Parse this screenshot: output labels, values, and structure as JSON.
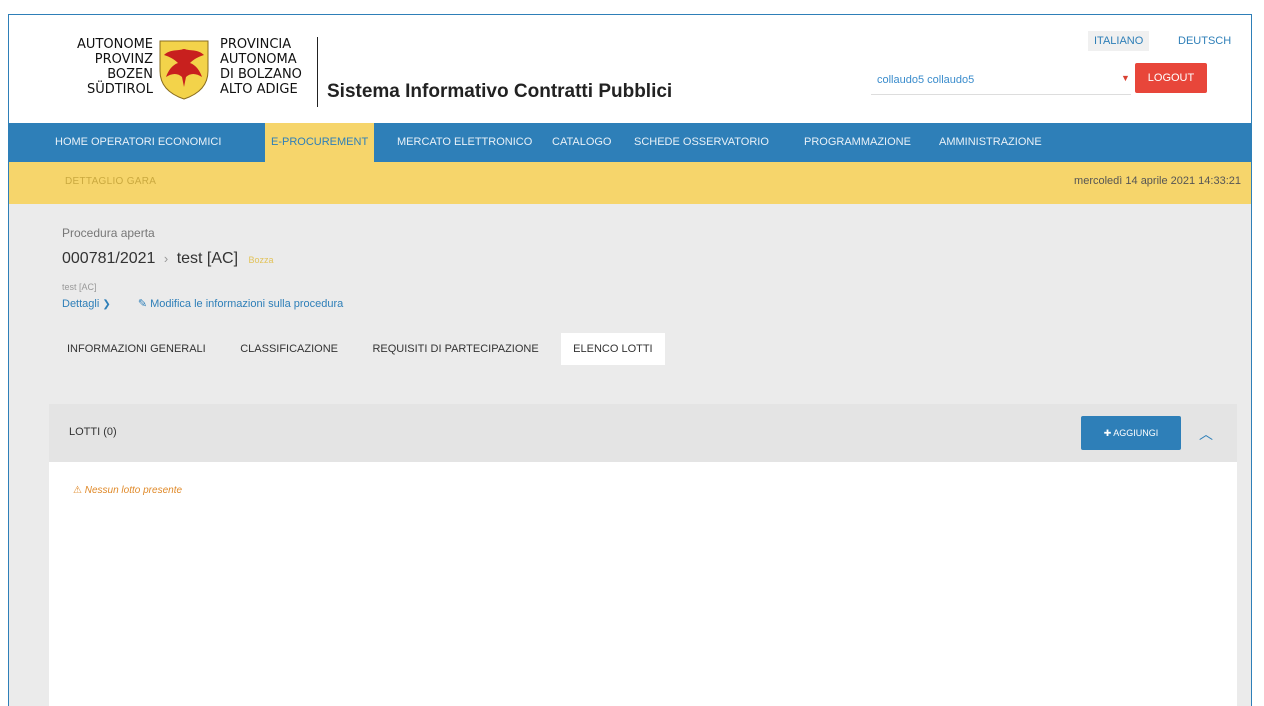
{
  "header": {
    "logo_left": [
      "AUTONOME",
      "PROVINZ",
      "BOZEN",
      "SÜDTIROL"
    ],
    "logo_right": [
      "PROVINCIA",
      "AUTONOMA",
      "DI BOLZANO",
      "ALTO ADIGE"
    ],
    "site_title": "Sistema Informativo Contratti Pubblici",
    "languages": [
      "ITALIANO",
      "DEUTSCH"
    ],
    "user": "collaudo5 collaudo5",
    "logout": "LOGOUT"
  },
  "nav": {
    "items": [
      "HOME",
      "OPERATORI ECONOMICI",
      "E-PROCUREMENT",
      "MERCATO ELETTRONICO",
      "CATALOGO",
      "SCHEDE OSSERVATORIO",
      "PROGRAMMAZIONE",
      "AMMINISTRAZIONE"
    ],
    "active": "E-PROCUREMENT"
  },
  "subbar": {
    "section": "DETTAGLIO GARA",
    "datetime": "mercoledì 14 aprile 2021 14:33:21"
  },
  "procedure": {
    "type": "Procedura aperta",
    "code": "000781/2021",
    "separator": "›",
    "name": "test [AC]",
    "status": "Bozza",
    "subtitle": "test [AC]",
    "details_link": "Dettagli",
    "edit_link": "Modifica le informazioni sulla procedura",
    "tabs": [
      "INFORMAZIONI GENERALI",
      "CLASSIFICAZIONE",
      "REQUISITI DI PARTECIPAZIONE",
      "ELENCO LOTTI"
    ],
    "active_tab": "ELENCO LOTTI"
  },
  "lots_panel": {
    "title": "LOTTI (0)",
    "add_button": "AGGIUNGI",
    "empty_message": "Nessun lotto presente"
  },
  "colors": {
    "primary_blue": "#2e7fb8",
    "accent_yellow": "#f6d56b",
    "logout_red": "#e8463a",
    "warning_orange": "#e08a2a"
  }
}
